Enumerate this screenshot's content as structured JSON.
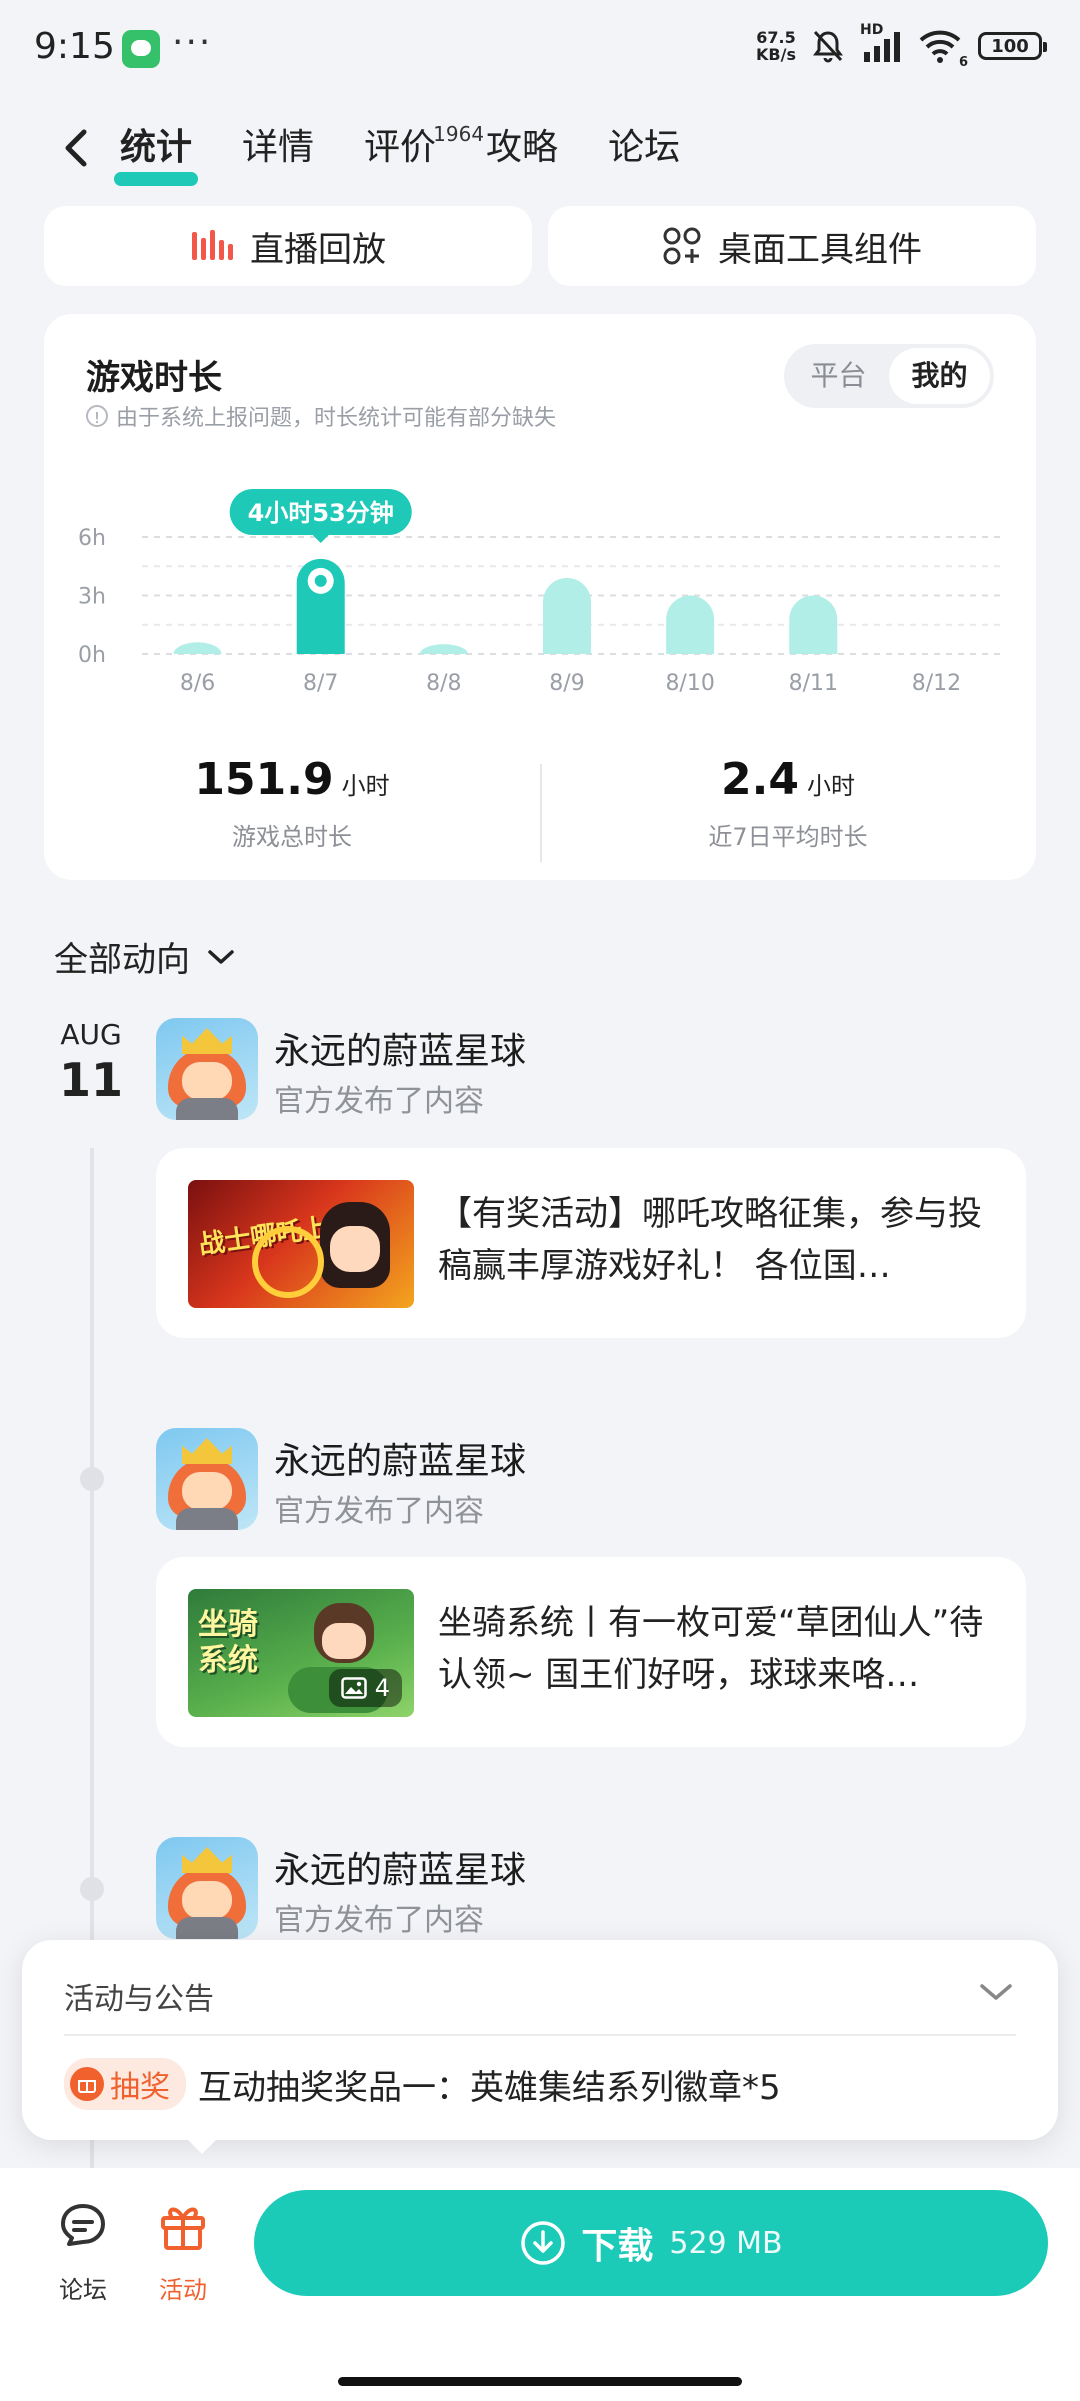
{
  "status_bar": {
    "time": "9:15",
    "more": "···",
    "net_speed_value": "67.5",
    "net_speed_unit": "KB/s",
    "signal_label": "HD",
    "wifi_label": "6",
    "battery": "100"
  },
  "nav": {
    "tabs": [
      {
        "label": "统计",
        "active": true
      },
      {
        "label": "详情"
      },
      {
        "label": "评价",
        "badge": "1964"
      },
      {
        "label": "攻略"
      },
      {
        "label": "论坛"
      }
    ]
  },
  "quick_actions": {
    "live_replay": "直播回放",
    "desktop_widget": "桌面工具组件"
  },
  "playtime": {
    "title": "游戏时长",
    "note": "由于系统上报问题，时长统计可能有部分缺失",
    "segment": {
      "platform": "平台",
      "mine": "我的"
    },
    "total_value": "151.9",
    "total_unit": "小时",
    "total_label": "游戏总时长",
    "avg_value": "2.4",
    "avg_unit": "小时",
    "avg_label": "近7日平均时长"
  },
  "chart_data": {
    "type": "bar",
    "categories": [
      "8/6",
      "8/7",
      "8/8",
      "8/9",
      "8/10",
      "8/11",
      "8/12"
    ],
    "values": [
      0.6,
      4.88,
      0.5,
      3.9,
      3.0,
      3.0,
      0
    ],
    "unit": "h",
    "ylim": [
      0,
      6
    ],
    "yticks": [
      "0h",
      "3h",
      "6h"
    ],
    "highlight_index": 1,
    "highlight_label": "4小时53分钟",
    "colors": {
      "highlight": "#1ec9b7",
      "normal": "#b1eee7",
      "grid": "#dcdde1"
    },
    "grid": true
  },
  "feed": {
    "filter_label": "全部动向",
    "date_month": "AUG",
    "date_day": "11",
    "posts": [
      {
        "publisher": "永远的蔚蓝星球",
        "action": "官方发布了内容",
        "text": "【有奖活动】哪吒攻略征集，参与投稿赢丰厚游戏好礼！ 各位国…",
        "thumb_text": "战士哪吒上手"
      },
      {
        "publisher": "永远的蔚蓝星球",
        "action": "官方发布了内容",
        "text": "坐骑系统丨有一枚可爱“草团仙人”待认领~ 国王们好呀，球球来咯…",
        "thumb_text": "坐骑系统",
        "image_count": "4"
      },
      {
        "publisher": "永远的蔚蓝星球",
        "action": "官方发布了内容"
      }
    ]
  },
  "announcement": {
    "title": "活动与公告",
    "tag": "抽奖",
    "text": "互动抽奖奖品一：英雄集结系列徽章*5"
  },
  "bottom_bar": {
    "forum": "论坛",
    "activity": "活动",
    "download_label": "下载",
    "download_size": "529 MB"
  }
}
